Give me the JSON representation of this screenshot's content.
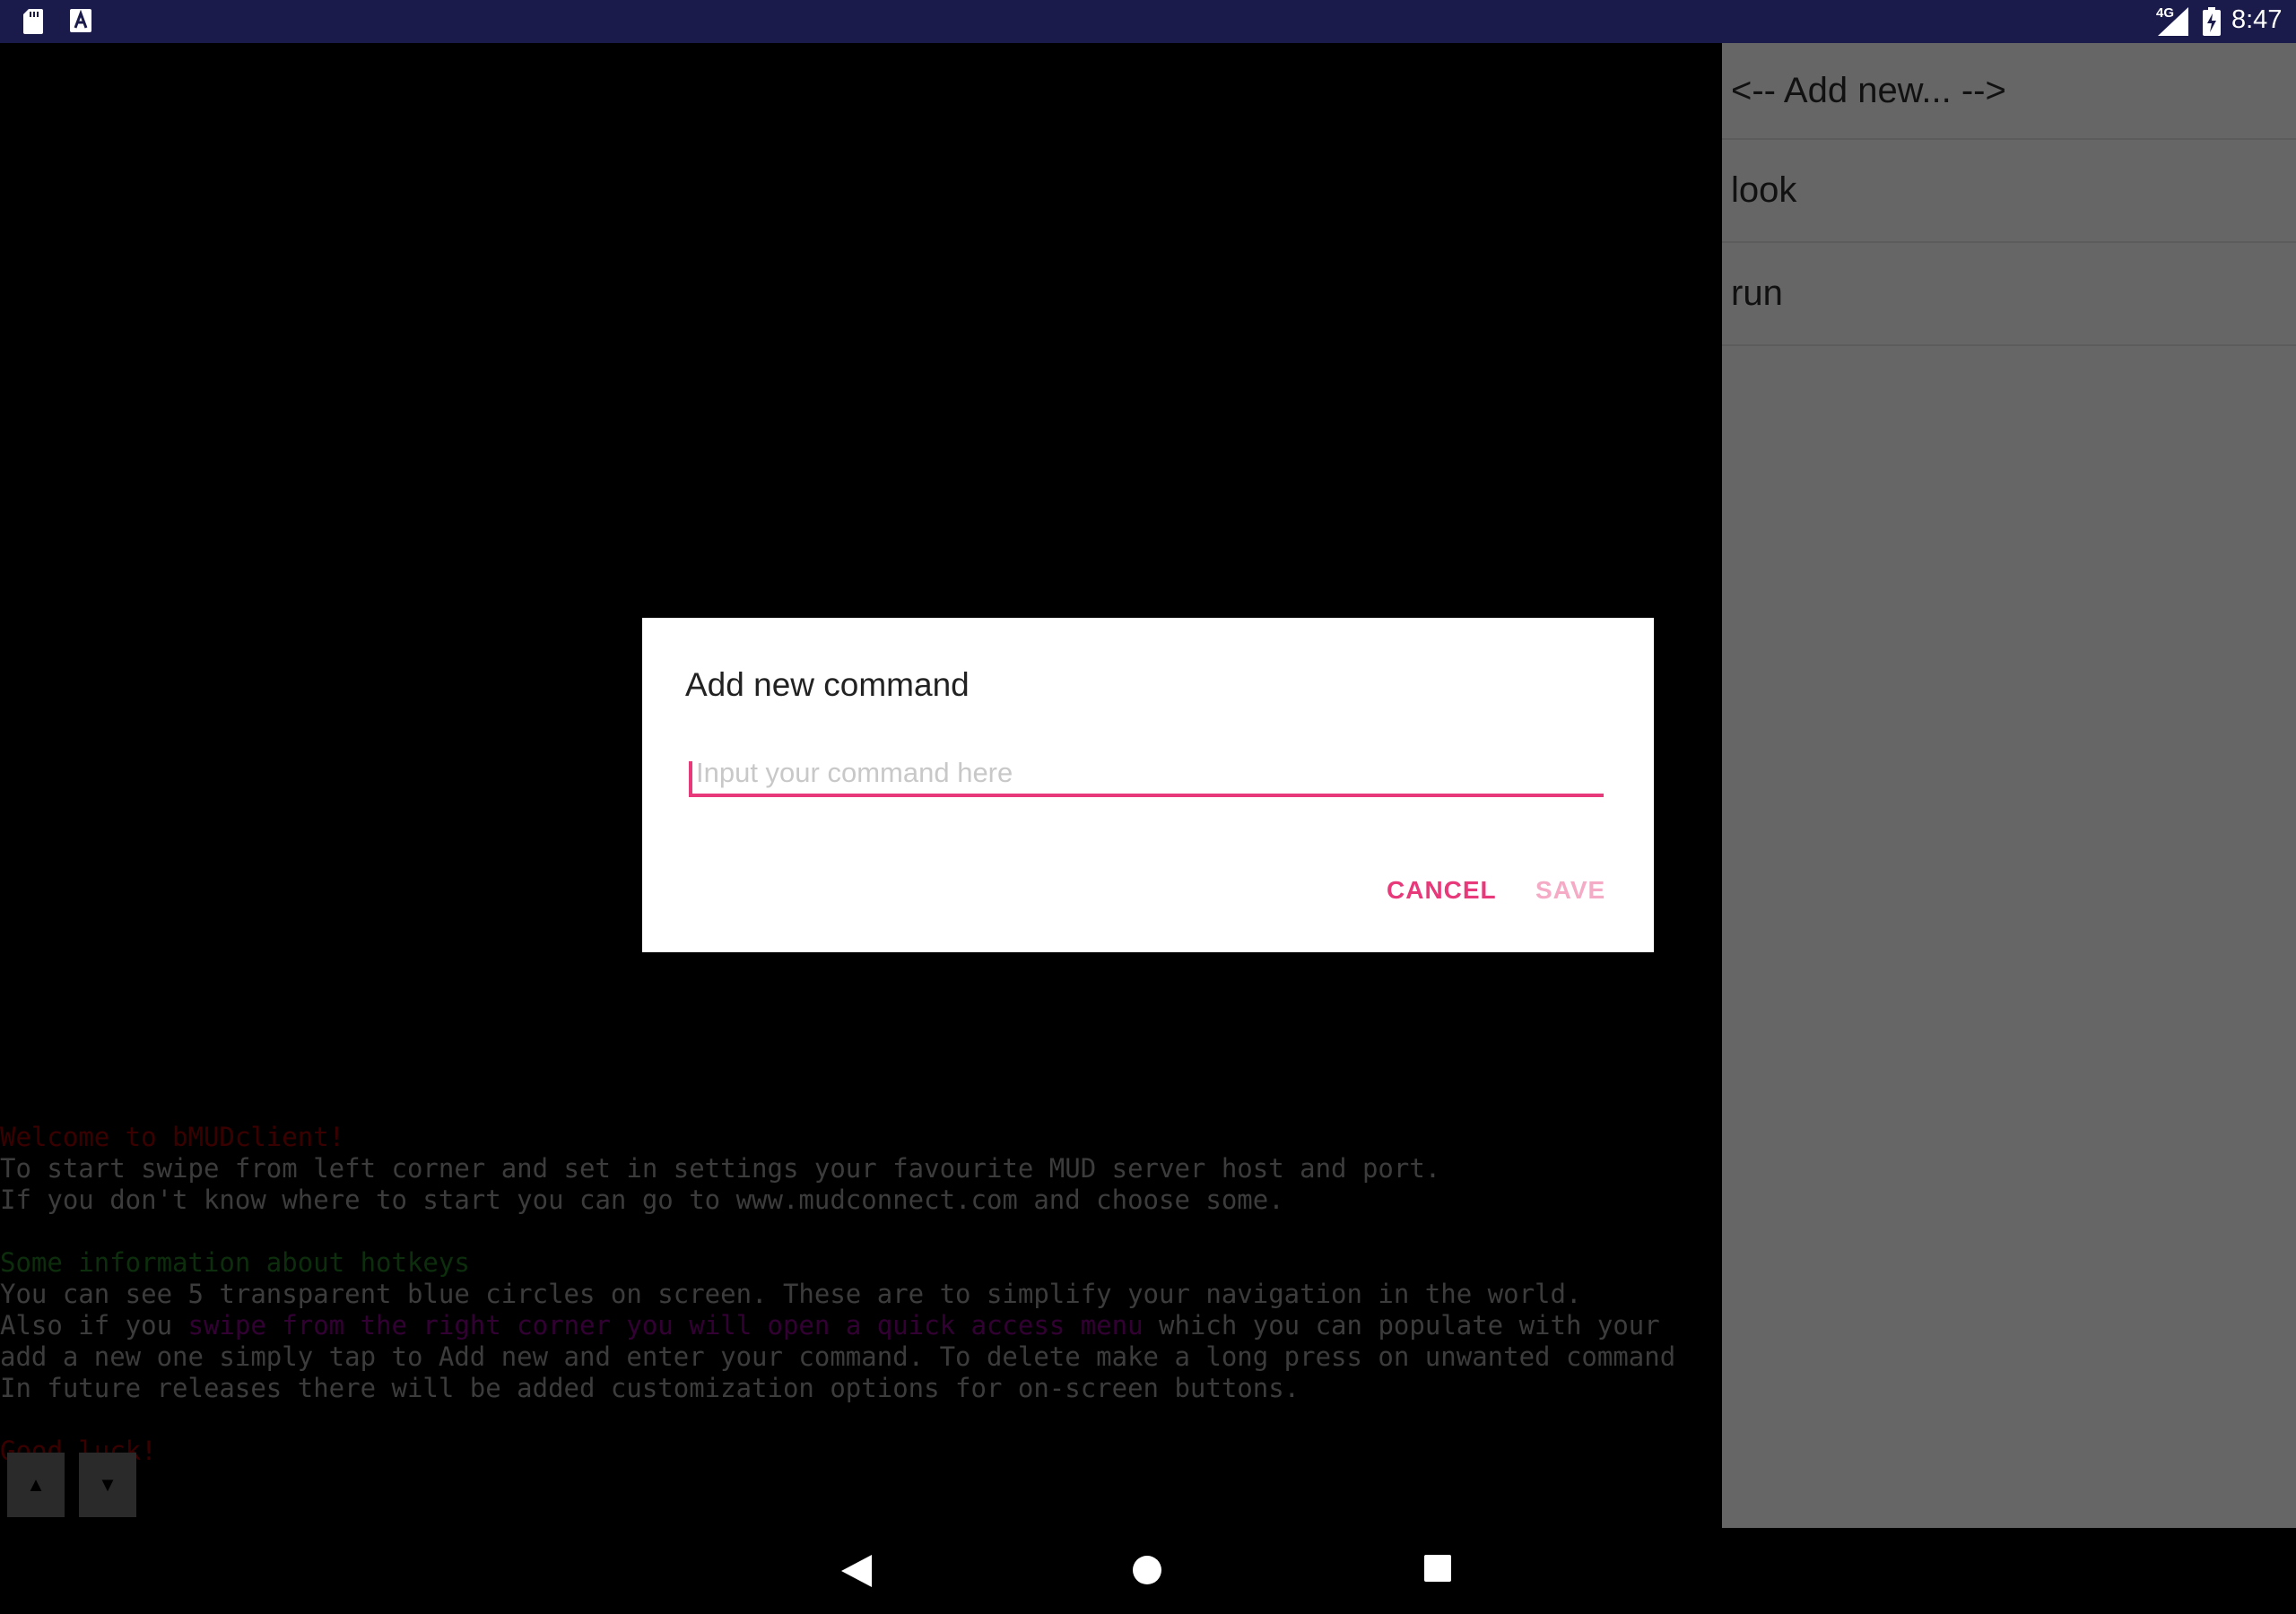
{
  "status_bar": {
    "network": "4G",
    "time": "8:47",
    "icons": [
      "sd-card-icon",
      "a-icon",
      "signal-icon",
      "battery-charging-icon"
    ]
  },
  "drawer": {
    "items": [
      {
        "label": "<-- Add new... -->"
      },
      {
        "label": "look"
      },
      {
        "label": "run"
      }
    ]
  },
  "dialog": {
    "title": "Add new command",
    "input_placeholder": "Input your command here",
    "input_value": "",
    "cancel_label": "CANCEL",
    "save_label": "SAVE"
  },
  "terminal": {
    "line1": "Welcome to bMUDclient!",
    "line2": "To start swipe from left corner and set in settings your favourite MUD server host and port.",
    "line3": "If you don't know where to start you can go to www.mudconnect.com and choose some.",
    "line4": "Some information about hotkeys",
    "line5": "You can see 5 transparent blue circles on screen. These are to simplify your navigation in the world.",
    "line6_pre": "Also if you ",
    "line6_highlight": "swipe from the right corner you will open a quick access menu",
    "line6_post": " which you can populate with your",
    "line7": "add a new one simply tap to Add new and enter your command. To delete make a long press on unwanted command",
    "line8": "In future releases there will be added customization options for on-screen buttons.",
    "line9": "Good luck!"
  },
  "scroll_buttons": {
    "up": "▲",
    "down": "▼"
  },
  "nav_bar": {
    "icons": [
      "back-icon",
      "home-icon",
      "recent-apps-icon"
    ]
  },
  "colors": {
    "accent": "#e8397a",
    "accent_disabled": "#f5aac6",
    "status_bar": "#1a1b4b",
    "drawer": "#666666"
  }
}
